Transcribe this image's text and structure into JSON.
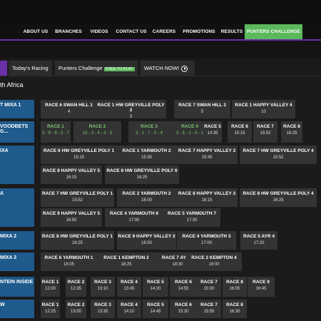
{
  "nav": [
    "ABOUT US",
    "BRANCHES",
    "VIDEOS",
    "CONTACT US",
    "CAREERS",
    "PROMOTIONS",
    "RESULTS",
    "PUNTERS CHALLENGE"
  ],
  "tabs": {
    "todays_racing": "Today's Racing",
    "punters": "Punters Challenge",
    "free": "FREE TO PLAY",
    "watch": "WATCH NOW!"
  },
  "section_title": "th Africa",
  "venues": [
    {
      "name": "T MIXA 1",
      "sub": ""
    },
    {
      "name": "VOODBETS G...",
      "sub": ""
    },
    {
      "name": "IXA",
      "sub": ""
    },
    {
      "name": "A",
      "sub": ""
    },
    {
      "name": "MIXA 2",
      "sub": ""
    },
    {
      "name": "MIXA 3",
      "sub": ""
    },
    {
      "name": "NTEIN INSIDE",
      "sub": ""
    },
    {
      "name": "W",
      "sub": ""
    }
  ],
  "races": [
    {
      "l1": "RACE 6 SWAN HILL 1",
      "l2": "4"
    },
    {
      "l1": "RACE 1 HW GREYVILLE POLY 2",
      "l2": "3"
    },
    {
      "l1": "RACE 7 SWAN HILL 3",
      "l2": "5"
    },
    {
      "l1": "RACE 1 HAPPY VALLEY 4",
      "l2": "10"
    },
    {
      "l1": "RACE 1",
      "l2": "3 - 9 - 8 - 2 - 7"
    },
    {
      "l1": "RACE 2",
      "l2": "10 - 2 - 4 - 3 - 5"
    },
    {
      "l1": "RACE 3",
      "l2": "3 - 1 - 7 - 5 - 4"
    },
    {
      "l1": "RACE 4",
      "l2": "3 - 5 - 2 - 4 - 1"
    },
    {
      "l1": "RACE 5",
      "l2": "14:35"
    },
    {
      "l1": "RACE 6",
      "l2": "15:15"
    },
    {
      "l1": "RACE 7",
      "l2": "15:52"
    },
    {
      "l1": "RACE 8",
      "l2": "16:25"
    },
    {
      "l1": "RACE 6 HW GREYVILLE POLY 1",
      "l2": "15:15"
    },
    {
      "l1": "RACE 1 YARMOUTH 2",
      "l2": "15:30"
    },
    {
      "l1": "RACE 7 HAPPY VALLEY 3",
      "l2": "15:45"
    },
    {
      "l1": "RACE 7 HW GREYVILLE POLY 4",
      "l2": "15:52"
    },
    {
      "l1": "RACE 8 HAPPY VALLEY 5",
      "l2": "16:15"
    },
    {
      "l1": "RACE 8 HW GREYVILLE POLY 6",
      "l2": "16:25"
    },
    {
      "l1": "RACE 7 HW GREYVILLE POLY 1",
      "l2": "15:52"
    },
    {
      "l1": "RACE 2 YARMOUTH 2",
      "l2": "16:00"
    },
    {
      "l1": "RACE 8 HAPPY VALLEY 3",
      "l2": "16:15"
    },
    {
      "l1": "RACE 8 HW GREYVILLE POLY 4",
      "l2": "16:25"
    },
    {
      "l1": "RACE 9 HAPPY VALLEY 5",
      "l2": "16:50"
    },
    {
      "l1": "RACE 4 YARMOUTH 6",
      "l2": "17:00"
    },
    {
      "l1": "RACE 5 YARMOUTH 7",
      "l2": "17:30"
    },
    {
      "l1": "RACE 8 HW GREYVILLE POLY 1",
      "l2": "16:25"
    },
    {
      "l1": "RACE 9 HAPPY VALLEY 2",
      "l2": "16:50"
    },
    {
      "l1": "RACE 4 YARMOUTH 3",
      "l2": "17:00"
    },
    {
      "l1": "RACE 5 AYR 4",
      "l2": "17:20"
    },
    {
      "l1": "RACE 6 YARMOUTH 1",
      "l2": "18:05"
    },
    {
      "l1": "RACE 1 KEMPTON 2",
      "l2": "18:25"
    },
    {
      "l1": "RACE 7 AYR 3",
      "l2": "18:30"
    },
    {
      "l1": "RACE 2 KEMPTON 4",
      "l2": "19:00"
    },
    {
      "l1": "RACE 1",
      "l2": "12:00"
    },
    {
      "l1": "RACE 2",
      "l2": "12:35"
    },
    {
      "l1": "RACE 3",
      "l2": "13:10"
    },
    {
      "l1": "RACE 4",
      "l2": "13:45"
    },
    {
      "l1": "RACE 5",
      "l2": "14:20"
    },
    {
      "l1": "RACE 6",
      "l2": "14:55"
    },
    {
      "l1": "RACE 7",
      "l2": "15:30"
    },
    {
      "l1": "RACE 8",
      "l2": "16:05"
    },
    {
      "l1": "RACE 9",
      "l2": "16:45"
    },
    {
      "l1": "RACE 1",
      "l2": "12:25"
    },
    {
      "l1": "RACE 2",
      "l2": "13:00"
    },
    {
      "l1": "RACE 3",
      "l2": "13:35"
    },
    {
      "l1": "RACE 4",
      "l2": "14:10"
    },
    {
      "l1": "RACE 5",
      "l2": "14:45"
    },
    {
      "l1": "RACE 6",
      "l2": "15:20"
    },
    {
      "l1": "RACE 7",
      "l2": "15:55"
    },
    {
      "l1": "RACE 8",
      "l2": "16:30"
    }
  ]
}
